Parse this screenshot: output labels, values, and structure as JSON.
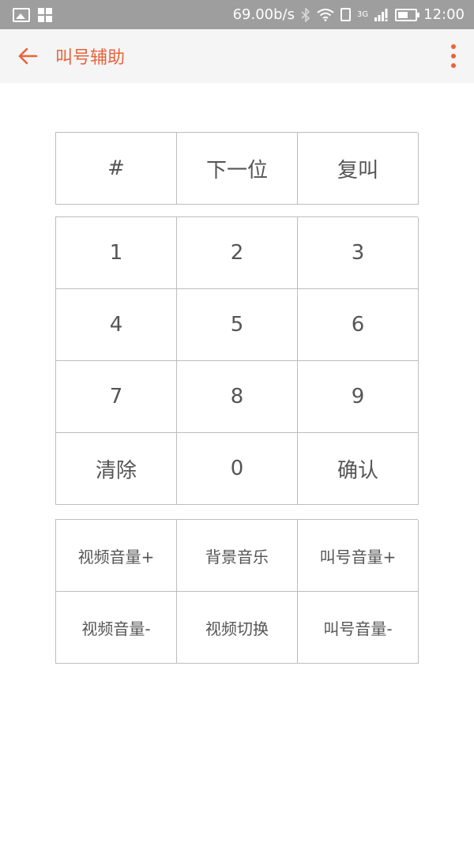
{
  "status_bar": {
    "speed": "69.00b/s",
    "network": "3G",
    "time": "12:00"
  },
  "app_bar": {
    "title": "叫号辅助",
    "accent_color": "#e8643c"
  },
  "pad_top": [
    "#",
    "下一位",
    "复叫"
  ],
  "pad_num": [
    "1",
    "2",
    "3",
    "4",
    "5",
    "6",
    "7",
    "8",
    "9",
    "清除",
    "0",
    "确认"
  ],
  "pad_vol": [
    "视频音量+",
    "背景音乐",
    "叫号音量+",
    "视频音量-",
    "视频切换",
    "叫号音量-"
  ]
}
